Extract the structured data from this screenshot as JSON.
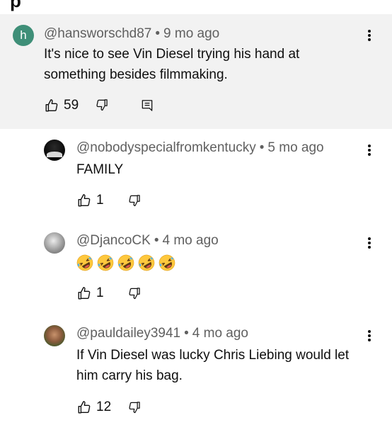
{
  "header_fragment": "p",
  "comment": {
    "avatar_letter": "h",
    "author": "@hansworschd87",
    "time": "9 mo ago",
    "text": "It's nice to see Vin Diesel trying his hand at something besides filmmaking.",
    "likes": "59"
  },
  "replies": [
    {
      "author": "@nobodyspecialfromkentucky",
      "time": "5 mo ago",
      "text": "FAMILY",
      "likes": "1"
    },
    {
      "author": "@DjancoCK",
      "time": "4 mo ago",
      "emoji": "rolling-on-floor-laughing x5",
      "likes": "1"
    },
    {
      "author": "@pauldailey3941",
      "time": "4 mo ago",
      "text": "If Vin Diesel was lucky Chris Liebing would let him carry his bag.",
      "likes": "12"
    }
  ],
  "colors": {
    "highlight_bg": "#f2f2f2",
    "avatar_h": "#3f8f78",
    "meta_text": "#606060",
    "text": "#0f0f0f"
  }
}
